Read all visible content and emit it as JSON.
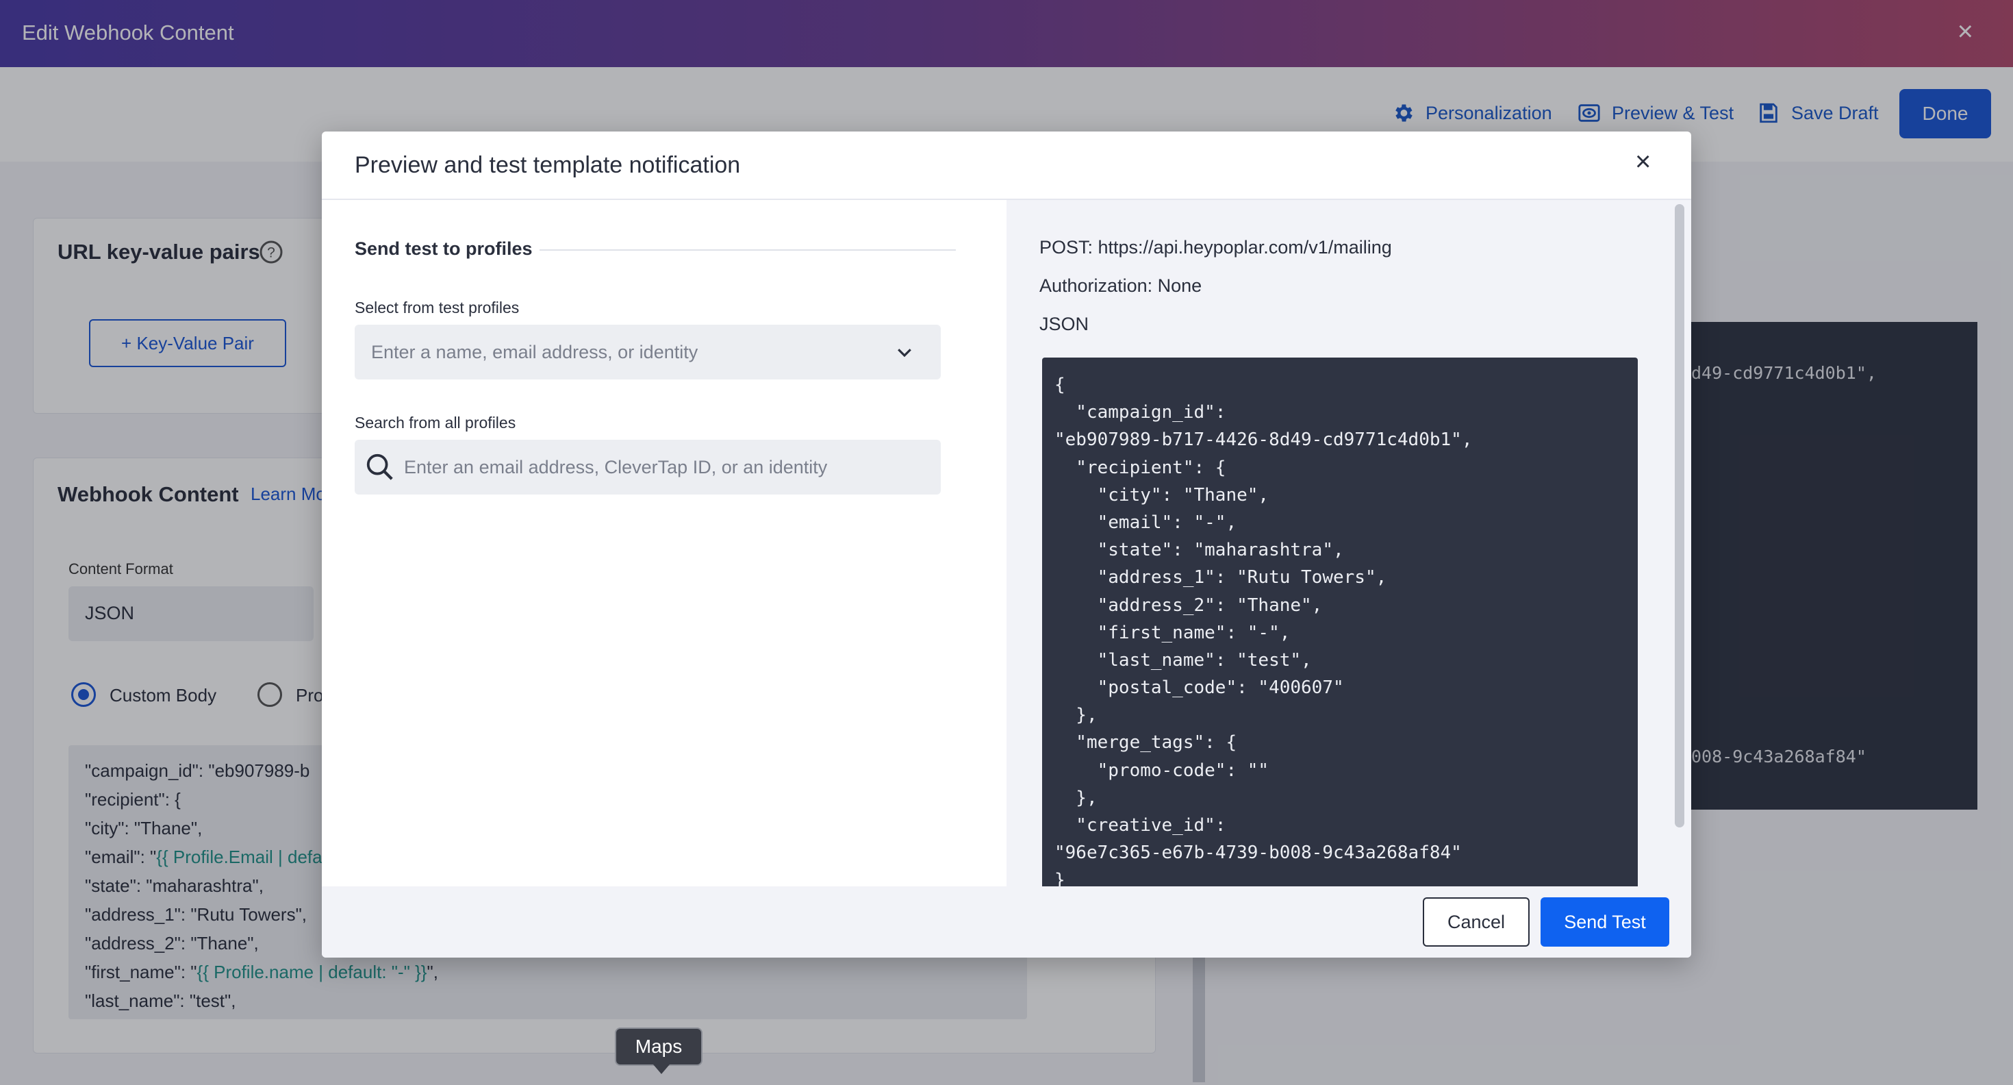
{
  "header": {
    "title": "Edit Webhook Content",
    "close_glyph": "×"
  },
  "toolbar": {
    "personalization": "Personalization",
    "preview_test": "Preview & Test",
    "save_draft": "Save Draft",
    "done": "Done",
    "accent": "#1a58c9"
  },
  "background": {
    "url_pairs_title": "URL key-value pairs",
    "kv_button": "+ Key-Value Pair",
    "webhook_title": "Webhook Content",
    "learn_more": "Learn Mo",
    "content_format_label": "Content Format",
    "content_format_value": "JSON",
    "radio_custom": "Custom Body",
    "radio_other": "Pro",
    "code_lines": [
      "\"campaign_id\": \"eb907989-b",
      "\"recipient\": {",
      "\"city\": \"Thane\",",
      "\"email\": \"",
      "\"state\": \"maharashtra\",",
      "\"address_1\": \"Rutu Towers\",",
      "\"address_2\": \"Thane\",",
      "\"first_name\": \"",
      "\"last_name\": \"test\","
    ],
    "code_tag_email": "{{ Profile.Email | defa",
    "code_tag_name": "{{ Profile.name | default: \"-\" }}",
    "code_tail_name": "\",",
    "right_dark_line_1": "d49-cd9771c4d0b1\",",
    "right_dark_line_2": "008-9c43a268af84\""
  },
  "modal": {
    "title": "Preview and test template notification",
    "close_glyph": "×",
    "send_test_section": "Send test to profiles",
    "select_label": "Select from test profiles",
    "select_placeholder": "Enter a name, email address, or identity",
    "search_label": "Search from all profiles",
    "search_placeholder": "Enter an email address, CleverTap ID, or an identity",
    "post_line": "POST: https://api.heypoplar.com/v1/mailing",
    "auth_line": "Authorization: None",
    "format_line": "JSON",
    "json_lines": [
      "{",
      "  \"campaign_id\":",
      "\"eb907989-b717-4426-8d49-cd9771c4d0b1\",",
      "  \"recipient\": {",
      "    \"city\": \"Thane\",",
      "    \"email\": \"-\",",
      "    \"state\": \"maharashtra\",",
      "    \"address_1\": \"Rutu Towers\",",
      "    \"address_2\": \"Thane\",",
      "    \"first_name\": \"-\",",
      "    \"last_name\": \"test\",",
      "    \"postal_code\": \"400607\"",
      "  },",
      "  \"merge_tags\": {",
      "    \"promo-code\": \"\"",
      "  },",
      "  \"creative_id\":",
      "\"96e7c365-e67b-4739-b008-9c43a268af84\"",
      "}"
    ],
    "cancel": "Cancel",
    "send_test": "Send Test"
  },
  "tooltip": "Maps"
}
